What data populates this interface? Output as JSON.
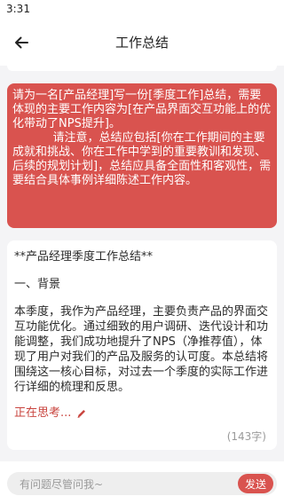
{
  "status_bar": {
    "time": "3:31"
  },
  "header": {
    "title": "工作总结",
    "back_icon": "arrow-left-icon"
  },
  "prompt": {
    "paragraph_1": "请为一名[产品经理]写一份[季度工作]总结，需要体现的主要工作内容为[在产品界面交互功能上的优化带动了NPS提升]。",
    "paragraph_2": "请注意，总结应包括[你在工作期间的主要成就和挑战、你在工作中学到的重要教训和发现、后续的规划计划]，总结应具备全面性和客观性，需要结合具体事例详细陈述工作内容。"
  },
  "answer": {
    "title": "**产品经理季度工作总结**",
    "section": "一、背景",
    "body": "本季度，我作为产品经理，主要负责产品的界面交互功能优化。通过细致的用户调研、迭代设计和功能调整，我们成功地提升了NPS（净推荐值），体现了用户对我们的产品及服务的认可度。本总结将围绕这一核心目标，对过去一个季度的实际工作进行详细的梳理和反思。",
    "thinking": "正在思考...",
    "char_count": "(143字)"
  },
  "input": {
    "placeholder": "有问题尽管问我~",
    "send_label": "发送"
  },
  "colors": {
    "accent": "#d9534f",
    "background": "#f4f4f6"
  }
}
